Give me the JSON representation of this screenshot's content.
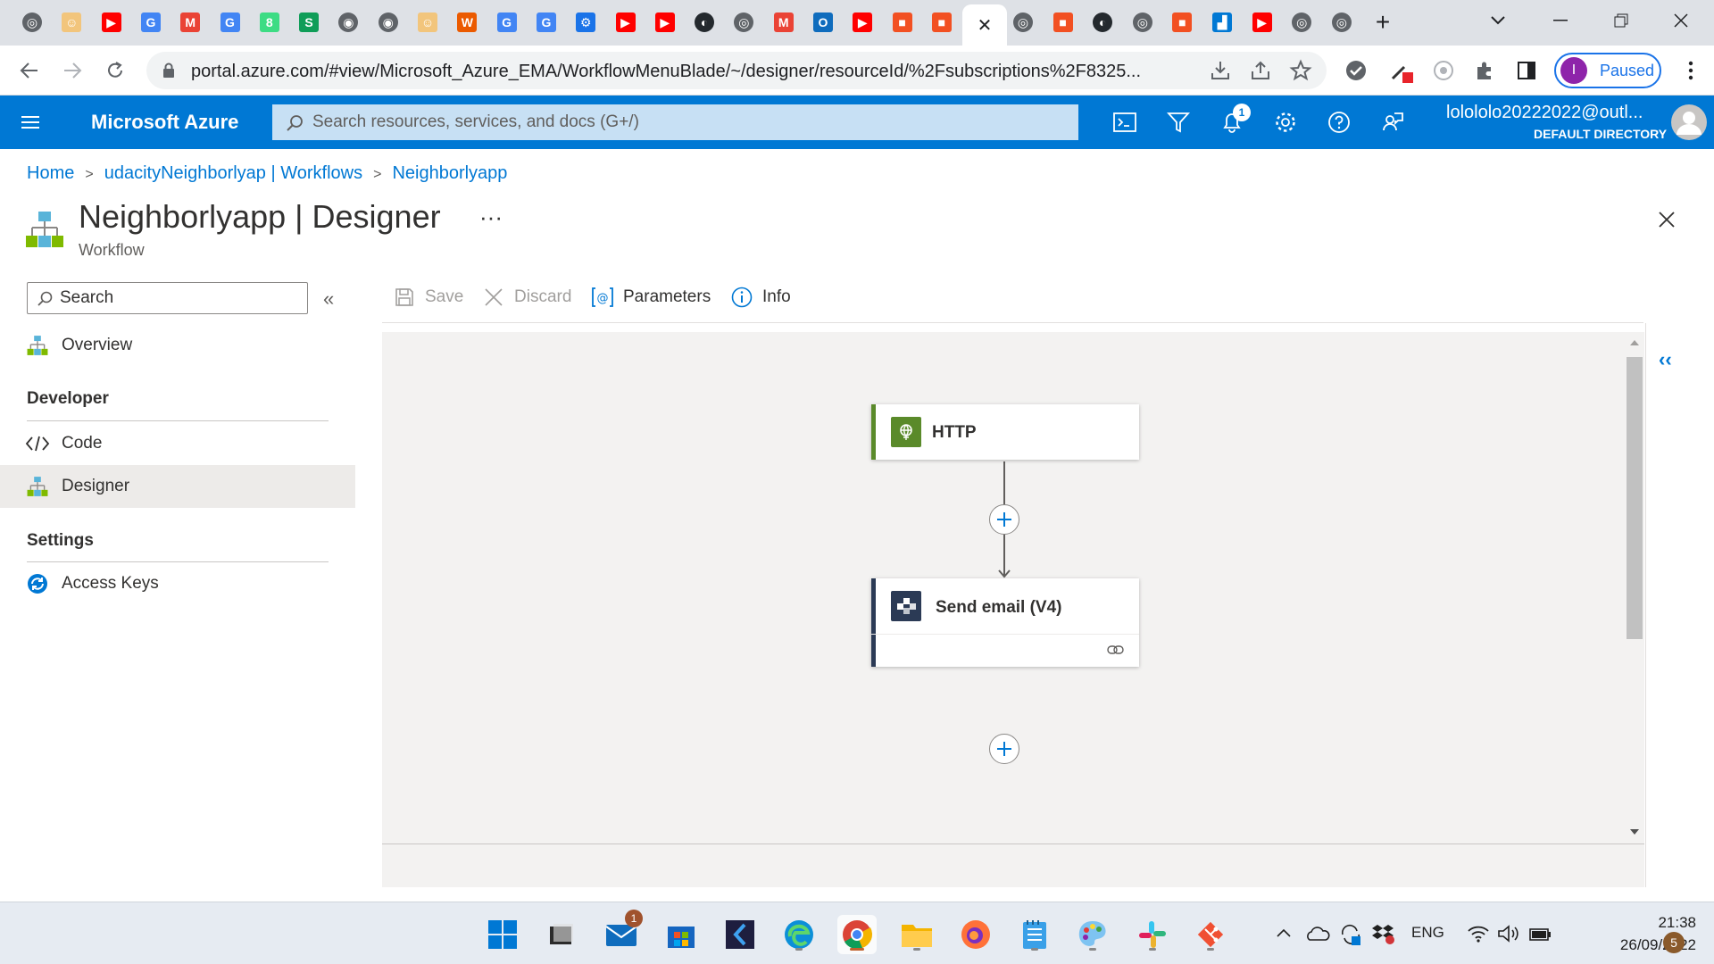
{
  "browser": {
    "tabs": [
      {
        "icon": "globe-icon"
      },
      {
        "icon": "face-icon"
      },
      {
        "icon": "youtube-icon"
      },
      {
        "icon": "google-icon"
      },
      {
        "icon": "gmail-icon"
      },
      {
        "icon": "google-icon"
      },
      {
        "icon": "android-icon"
      },
      {
        "icon": "sheet-icon"
      },
      {
        "icon": "chrome-icon"
      },
      {
        "icon": "chrome-icon"
      },
      {
        "icon": "face-icon"
      },
      {
        "icon": "office-icon"
      },
      {
        "icon": "google-icon"
      },
      {
        "icon": "google-icon"
      },
      {
        "icon": "gear-icon"
      },
      {
        "icon": "youtube-icon"
      },
      {
        "icon": "youtube-icon"
      },
      {
        "icon": "github-icon"
      },
      {
        "icon": "globe-icon"
      },
      {
        "icon": "gmail-icon"
      },
      {
        "icon": "outlook-icon"
      },
      {
        "icon": "youtube-icon"
      },
      {
        "icon": "microsoft-icon"
      },
      {
        "icon": "microsoft-icon"
      }
    ],
    "active_tab_close": "✕",
    "tabs_after": [
      {
        "icon": "globe-icon"
      },
      {
        "icon": "microsoft-icon"
      },
      {
        "icon": "github-icon"
      },
      {
        "icon": "globe-icon"
      },
      {
        "icon": "microsoft-icon"
      },
      {
        "icon": "azure-icon"
      },
      {
        "icon": "youtube-icon"
      },
      {
        "icon": "globe-icon"
      },
      {
        "icon": "globe-icon"
      }
    ],
    "new_tab": "+",
    "url": "portal.azure.com/#view/Microsoft_Azure_EMA/WorkflowMenuBlade/~/designer/resourceId/%2Fsubscriptions%2F8325...",
    "profile_initial": "I",
    "profile_status": "Paused"
  },
  "azure": {
    "brand": "Microsoft Azure",
    "search_placeholder": "Search resources, services, and docs (G+/)",
    "notification_count": "1",
    "account_email": "lolololo20222022@outl...",
    "account_directory": "DEFAULT DIRECTORY",
    "header_icons": [
      "cloud-shell-icon",
      "directory-filter-icon",
      "bell-icon",
      "gear-icon",
      "help-icon",
      "feedback-icon"
    ]
  },
  "breadcrumb": [
    {
      "label": "Home"
    },
    {
      "label": "udacityNeighborlyap | Workflows"
    },
    {
      "label": "Neighborlyapp"
    }
  ],
  "page": {
    "title": "Neighborlyapp | Designer",
    "subtitle": "Workflow",
    "more": "···"
  },
  "nav": {
    "search_placeholder": "Search",
    "collapse": "«",
    "overview": "Overview",
    "section_developer": "Developer",
    "code": "Code",
    "designer": "Designer",
    "section_settings": "Settings",
    "access_keys": "Access Keys"
  },
  "commands": {
    "save": "Save",
    "discard": "Discard",
    "parameters": "Parameters",
    "info": "Info"
  },
  "designer": {
    "trigger": {
      "title": "HTTP",
      "color": "#5a8a2a"
    },
    "action": {
      "title": "Send email (V4)",
      "color": "#2b3a55"
    },
    "expand": "‹‹"
  },
  "taskbar": {
    "apps": [
      "start-icon",
      "terminal-icon",
      "mail-icon",
      "store-icon",
      "vscode-icon",
      "edge-icon",
      "chrome-icon",
      "file-explorer-icon",
      "firefox-icon",
      "notepad-icon",
      "paint-icon",
      "slack-icon",
      "git-icon"
    ],
    "mail_badge": "1",
    "language": "ENG",
    "time": "21:38",
    "date": "26/09/2022",
    "notifications": "5"
  }
}
